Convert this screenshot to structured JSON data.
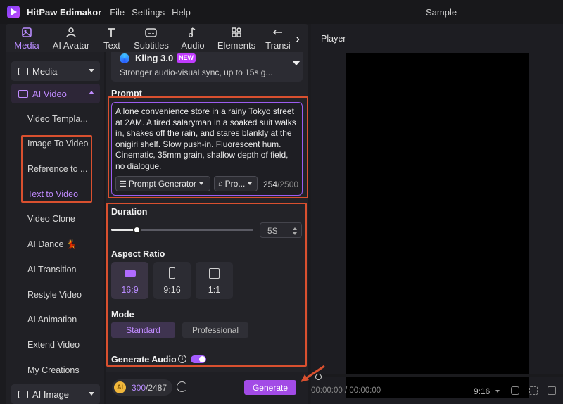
{
  "window": {
    "app_name": "HitPaw Edimakor",
    "project_name": "Sample"
  },
  "menu": [
    "File",
    "Settings",
    "Help"
  ],
  "tabs": [
    {
      "label": "Media",
      "icon": "media-icon",
      "active": true
    },
    {
      "label": "AI Avatar",
      "icon": "avatar-icon"
    },
    {
      "label": "Text",
      "icon": "text-icon"
    },
    {
      "label": "Subtitles",
      "icon": "subtitles-icon"
    },
    {
      "label": "Audio",
      "icon": "music-note-icon"
    },
    {
      "label": "Elements",
      "icon": "elements-icon"
    },
    {
      "label": "Transi",
      "icon": "transition-icon"
    }
  ],
  "sidebar": {
    "media": "Media",
    "ai_video": "AI Video",
    "items": [
      "Video Templa...",
      "Image To Video",
      "Reference to ...",
      "Text to Video",
      "Video Clone",
      "AI Dance 💃",
      "AI Transition",
      "Restyle Video",
      "AI Animation",
      "Extend Video",
      "My Creations"
    ],
    "active_item": "Text to Video",
    "ai_image": "AI Image"
  },
  "model": {
    "name": "Kling 3.0",
    "badge": "NEW",
    "description": "Stronger audio-visual sync, up to 15s g..."
  },
  "prompt": {
    "title": "Prompt",
    "text": "A lone convenience store in a rainy Tokyo street at 2AM. A tired salaryman in a soaked suit walks in, shakes off the rain, and stares blankly at the onigiri shelf. Slow push-in. Fluorescent hum. Cinematic, 35mm grain, shallow depth of field, no dialogue.",
    "generator_label": "Prompt Generator",
    "preset_label": "Pro...",
    "char_count": "254",
    "char_max": "/2500"
  },
  "duration": {
    "title": "Duration",
    "value": "5S",
    "level": 0.18
  },
  "aspect_ratio": {
    "title": "Aspect Ratio",
    "options": [
      "16:9",
      "9:16",
      "1:1"
    ],
    "selected": "16:9"
  },
  "mode": {
    "title": "Mode",
    "options": [
      "Standard",
      "Professional"
    ],
    "selected": "Standard"
  },
  "generate_audio": {
    "label": "Generate Audio",
    "enabled": true
  },
  "footer": {
    "credits": "300",
    "credits_total": "/2487",
    "generate_label": "Generate"
  },
  "player": {
    "title": "Player",
    "timecode": "00:00:00 / 00:00:00",
    "ratio": "9:16"
  },
  "colors": {
    "accent": "#a24be6",
    "annotation": "#d9502f"
  }
}
